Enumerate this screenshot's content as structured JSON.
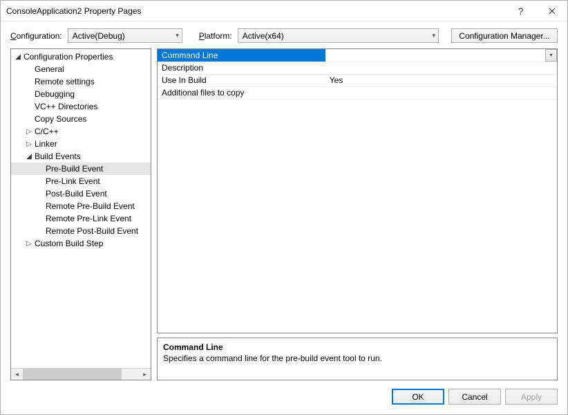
{
  "window": {
    "title": "ConsoleApplication2 Property Pages"
  },
  "toolbar": {
    "config_label": "Configuration:",
    "config_value": "Active(Debug)",
    "platform_label": "Platform:",
    "platform_value": "Active(x64)",
    "config_mgr_label": "Configuration Manager..."
  },
  "tree": {
    "root": "Configuration Properties",
    "items": [
      {
        "label": "General",
        "level": 2
      },
      {
        "label": "Remote settings",
        "level": 2
      },
      {
        "label": "Debugging",
        "level": 2
      },
      {
        "label": "VC++ Directories",
        "level": 2
      },
      {
        "label": "Copy Sources",
        "level": 2
      },
      {
        "label": "C/C++",
        "level": 2,
        "expander": "collapsed"
      },
      {
        "label": "Linker",
        "level": 2,
        "expander": "collapsed"
      },
      {
        "label": "Build Events",
        "level": 2,
        "expander": "expanded"
      },
      {
        "label": "Pre-Build Event",
        "level": 3,
        "selected": true
      },
      {
        "label": "Pre-Link Event",
        "level": 3
      },
      {
        "label": "Post-Build Event",
        "level": 3
      },
      {
        "label": "Remote Pre-Build Event",
        "level": 3
      },
      {
        "label": "Remote Pre-Link Event",
        "level": 3
      },
      {
        "label": "Remote Post-Build Event",
        "level": 3
      },
      {
        "label": "Custom Build Step",
        "level": 2,
        "expander": "collapsed"
      }
    ]
  },
  "grid": {
    "rows": [
      {
        "key": "Command Line",
        "value": "",
        "selected": true,
        "dropdown": true
      },
      {
        "key": "Description",
        "value": ""
      },
      {
        "key": "Use In Build",
        "value": "Yes"
      },
      {
        "key": "Additional files to copy",
        "value": ""
      }
    ]
  },
  "description": {
    "title": "Command Line",
    "text": "Specifies a command line for the pre-build event tool to run."
  },
  "buttons": {
    "ok": "OK",
    "cancel": "Cancel",
    "apply": "Apply"
  }
}
